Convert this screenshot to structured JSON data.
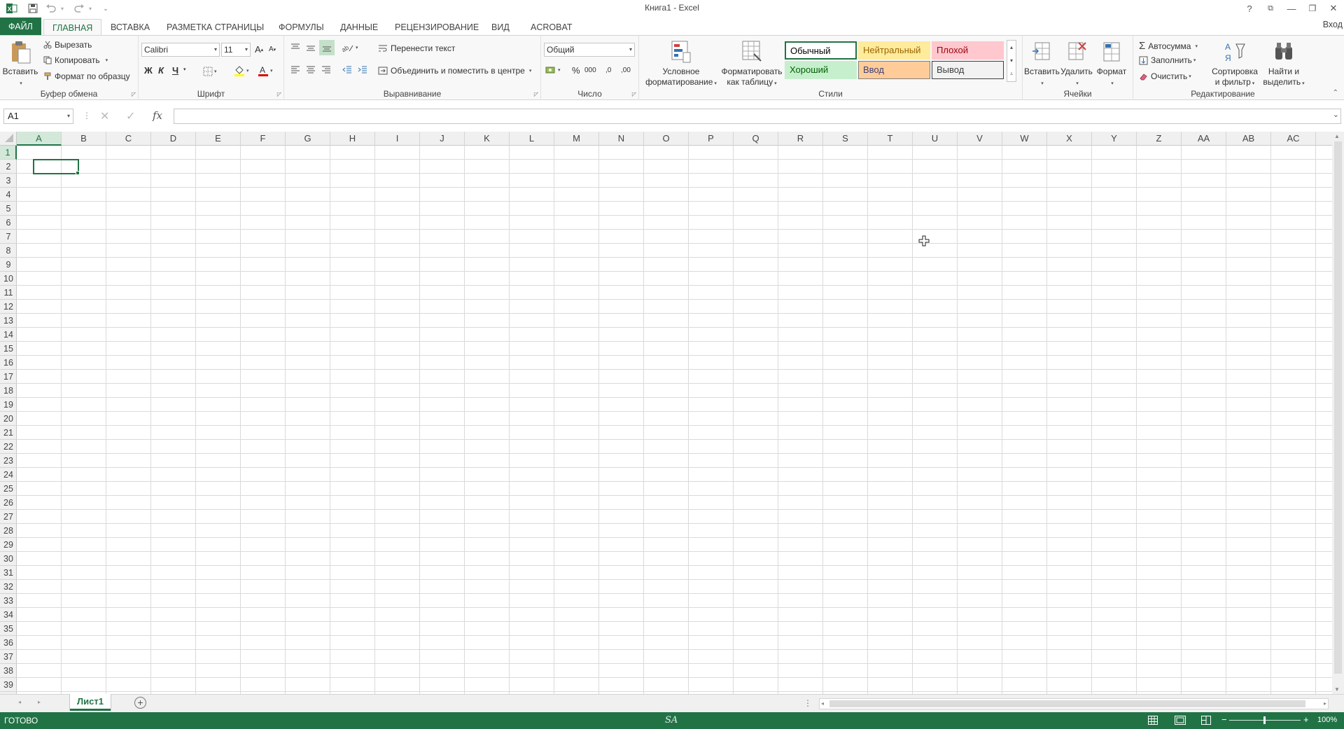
{
  "window": {
    "title": "Книга1 - Excel",
    "controls": {
      "help": "?",
      "restore": "⧉",
      "minimize": "—",
      "maximize": "❐",
      "close": "✕"
    }
  },
  "quick_access": [
    "save-icon",
    "undo-icon",
    "redo-icon",
    "customize-icon"
  ],
  "tabs": [
    {
      "label": "ФАЙЛ",
      "active": false
    },
    {
      "label": "ГЛАВНАЯ",
      "active": true
    },
    {
      "label": "ВСТАВКА",
      "active": false
    },
    {
      "label": "РАЗМЕТКА СТРАНИЦЫ",
      "active": false
    },
    {
      "label": "ФОРМУЛЫ",
      "active": false
    },
    {
      "label": "ДАННЫЕ",
      "active": false
    },
    {
      "label": "РЕЦЕНЗИРОВАНИЕ",
      "active": false
    },
    {
      "label": "ВИД",
      "active": false
    },
    {
      "label": "ACROBAT",
      "active": false
    }
  ],
  "sign_in": "Вход",
  "ribbon": {
    "clipboard": {
      "label": "Буфер обмена",
      "paste": "Вставить",
      "cut": "Вырезать",
      "copy": "Копировать",
      "format_painter": "Формат по образцу"
    },
    "font": {
      "label": "Шрифт",
      "font_name": "Calibri",
      "font_size": "11",
      "bold": "Ж",
      "italic": "К",
      "underline": "Ч",
      "grow": "A",
      "shrink": "A"
    },
    "alignment": {
      "label": "Выравнивание",
      "wrap_text": "Перенести текст",
      "merge_center": "Объединить и поместить в центре"
    },
    "number": {
      "label": "Число",
      "format": "Общий",
      "percent": "%",
      "thousands": "000",
      "inc_decimal": ",0",
      "dec_decimal": ",00"
    },
    "styles": {
      "label": "Стили",
      "conditional_line1": "Условное",
      "conditional_line2": "форматирование",
      "table_line1": "Форматировать",
      "table_line2": "как таблицу",
      "cells": [
        {
          "label": "Обычный",
          "bg": "#ffffff",
          "fg": "#000000",
          "border": "#217346"
        },
        {
          "label": "Нейтральный",
          "bg": "#ffeb9c",
          "fg": "#9c6500",
          "border": "#ffeb9c"
        },
        {
          "label": "Плохой",
          "bg": "#ffc7ce",
          "fg": "#9c0006",
          "border": "#ffc7ce"
        },
        {
          "label": "Хороший",
          "bg": "#c6efce",
          "fg": "#006100",
          "border": "#c6efce"
        },
        {
          "label": "Ввод",
          "bg": "#ffcc99",
          "fg": "#3f3f76",
          "border": "#7f7f7f"
        },
        {
          "label": "Вывод",
          "bg": "#f2f2f2",
          "fg": "#3f3f3f",
          "border": "#3f3f3f"
        }
      ]
    },
    "cells": {
      "label": "Ячейки",
      "insert": "Вставить",
      "delete": "Удалить",
      "format": "Формат"
    },
    "editing": {
      "label": "Редактирование",
      "autosum": "Автосумма",
      "fill": "Заполнить",
      "clear": "Очистить",
      "sort_line1": "Сортировка",
      "sort_line2": "и фильтр",
      "find_line1": "Найти и",
      "find_line2": "выделить"
    }
  },
  "formula_bar": {
    "name_box": "A1",
    "fx": "fx",
    "formula": ""
  },
  "grid": {
    "columns": [
      "A",
      "B",
      "C",
      "D",
      "E",
      "F",
      "G",
      "H",
      "I",
      "J",
      "K",
      "L",
      "M",
      "N",
      "O",
      "P",
      "Q",
      "R",
      "S",
      "T",
      "U",
      "V",
      "W",
      "X",
      "Y",
      "Z",
      "AA",
      "AB",
      "AC"
    ],
    "rows": [
      "1",
      "2",
      "3",
      "4",
      "5",
      "6",
      "7",
      "8",
      "9",
      "10",
      "11",
      "12",
      "13",
      "14",
      "15",
      "16",
      "17",
      "18",
      "19",
      "20",
      "21",
      "22",
      "23",
      "24",
      "25",
      "26",
      "27",
      "28",
      "29",
      "30",
      "31",
      "32",
      "33",
      "34",
      "35",
      "36",
      "37",
      "38",
      "39"
    ],
    "active_cell": "A1"
  },
  "sheets": [
    {
      "label": "Лист1",
      "active": true
    }
  ],
  "status": {
    "ready": "ГОТОВО",
    "zoom": "100%",
    "watermark": "SA"
  },
  "colors": {
    "accent": "#217346",
    "status_bar": "#217346"
  }
}
